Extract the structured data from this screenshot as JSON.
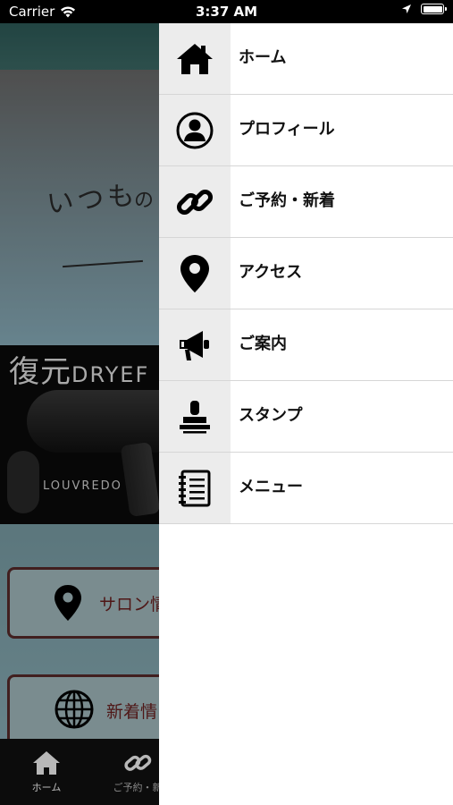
{
  "status_bar": {
    "carrier": "Carrier",
    "time": "3:37 AM"
  },
  "background": {
    "banner_text_1": "いつも",
    "banner_text_2": "の",
    "dryer_title_kanji": "復元",
    "dryer_title_latin": "DRYEF",
    "dryer_brand": "LOUVREDO",
    "card_salon": "サロン情",
    "card_news": "新着情",
    "tab_home": "ホーム",
    "tab_reserve": "ご予約・新"
  },
  "drawer": {
    "items": [
      {
        "label": "ホーム",
        "icon": "home-icon"
      },
      {
        "label": "プロフィール",
        "icon": "profile-icon"
      },
      {
        "label": "ご予約・新着",
        "icon": "link-icon"
      },
      {
        "label": "アクセス",
        "icon": "map-pin-icon"
      },
      {
        "label": "ご案内",
        "icon": "megaphone-icon"
      },
      {
        "label": "スタンプ",
        "icon": "stamp-icon"
      },
      {
        "label": "メニュー",
        "icon": "notebook-icon"
      }
    ]
  },
  "colors": {
    "drawer_bg": "#ffffff",
    "icon_column_bg": "#ececec",
    "divider": "#d6d6d6",
    "accent_text": "#6e2020"
  }
}
